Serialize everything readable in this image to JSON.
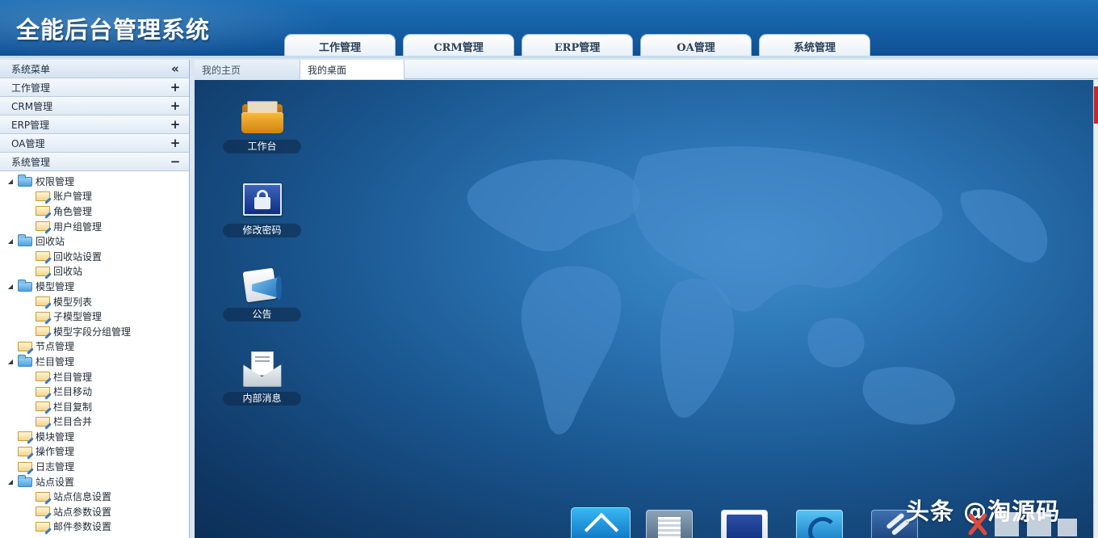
{
  "app": {
    "title": "全能后台管理系统"
  },
  "top_tabs": [
    {
      "label": "工作管理"
    },
    {
      "label": "CRM管理"
    },
    {
      "label": "ERP管理"
    },
    {
      "label": "OA管理"
    },
    {
      "label": "系统管理"
    }
  ],
  "sidebar": {
    "header": "系统菜单",
    "header_toggle": "«",
    "sections": [
      {
        "label": "工作管理",
        "toggle": "+"
      },
      {
        "label": "CRM管理",
        "toggle": "+"
      },
      {
        "label": "ERP管理",
        "toggle": "+"
      },
      {
        "label": "OA管理",
        "toggle": "+"
      },
      {
        "label": "系统管理",
        "toggle": "−"
      }
    ],
    "tree": [
      {
        "label": "权限管理",
        "level": 0,
        "expanded": true,
        "icon": "folder-icon"
      },
      {
        "label": "账户管理",
        "level": 1,
        "icon": "page-icon"
      },
      {
        "label": "角色管理",
        "level": 1,
        "icon": "page-icon"
      },
      {
        "label": "用户组管理",
        "level": 1,
        "icon": "page-icon"
      },
      {
        "label": "回收站",
        "level": 0,
        "expanded": true,
        "icon": "folder-icon"
      },
      {
        "label": "回收站设置",
        "level": 1,
        "icon": "page-icon"
      },
      {
        "label": "回收站",
        "level": 1,
        "icon": "page-icon"
      },
      {
        "label": "模型管理",
        "level": 0,
        "expanded": true,
        "icon": "folder-icon"
      },
      {
        "label": "模型列表",
        "level": 1,
        "icon": "page-icon"
      },
      {
        "label": "子模型管理",
        "level": 1,
        "icon": "page-icon"
      },
      {
        "label": "模型字段分组管理",
        "level": 1,
        "icon": "page-icon"
      },
      {
        "label": "节点管理",
        "level": 0,
        "icon": "page-icon"
      },
      {
        "label": "栏目管理",
        "level": 0,
        "expanded": true,
        "icon": "folder-icon"
      },
      {
        "label": "栏目管理",
        "level": 1,
        "icon": "page-icon"
      },
      {
        "label": "栏目移动",
        "level": 1,
        "icon": "page-icon"
      },
      {
        "label": "栏目复制",
        "level": 1,
        "icon": "page-icon"
      },
      {
        "label": "栏目合并",
        "level": 1,
        "icon": "page-icon"
      },
      {
        "label": "模块管理",
        "level": 0,
        "icon": "page-icon"
      },
      {
        "label": "操作管理",
        "level": 0,
        "icon": "page-icon"
      },
      {
        "label": "日志管理",
        "level": 0,
        "icon": "page-icon"
      },
      {
        "label": "站点设置",
        "level": 0,
        "expanded": true,
        "icon": "folder-icon"
      },
      {
        "label": "站点信息设置",
        "level": 1,
        "icon": "page-icon"
      },
      {
        "label": "站点参数设置",
        "level": 1,
        "icon": "page-icon"
      },
      {
        "label": "邮件参数设置",
        "level": 1,
        "icon": "page-icon"
      }
    ]
  },
  "main_tabs": [
    {
      "label": "我的主页"
    },
    {
      "label": "我的桌面",
      "active": true
    }
  ],
  "desktop": {
    "icons": [
      {
        "label": "工作台",
        "icon": "folder-icon"
      },
      {
        "label": "修改密码",
        "icon": "lock-icon"
      },
      {
        "label": "公告",
        "icon": "megaphone-icon"
      },
      {
        "label": "内部消息",
        "icon": "mail-icon"
      }
    ],
    "dock": [
      "home-icon",
      "document-icon",
      "user-icon",
      "browser-icon",
      "tools-icon"
    ]
  },
  "watermark": {
    "text": "头条 @淘源码"
  },
  "colors": {
    "header": "#1560a6",
    "desktop": "#1a568f",
    "accent": "#0d74c4"
  }
}
